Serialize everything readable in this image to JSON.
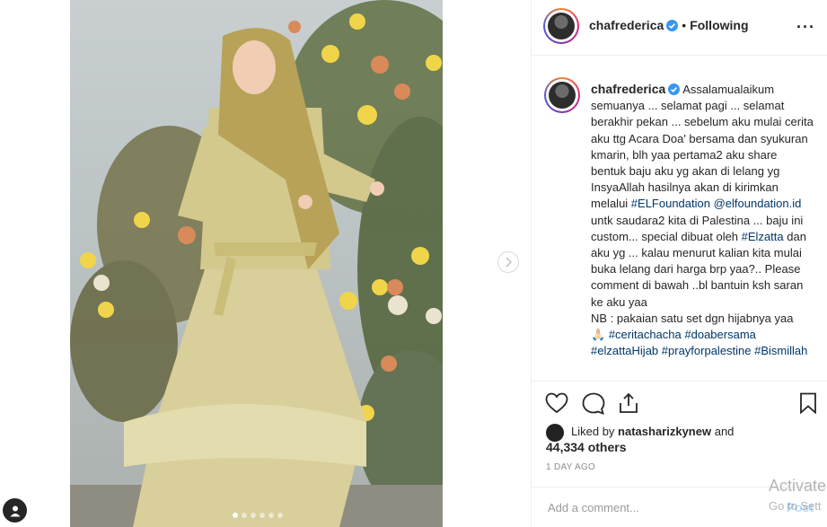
{
  "post": {
    "username": "chafrederica",
    "follow_state": "Following",
    "bullet": "•",
    "more_icon": "···",
    "caption_segments": [
      {
        "t": "Assalamualaikum semuanya ... selamat pagi ... selamat berakhir pekan ... sebelum aku mulai cerita aku ttg Acara Doa' bersama dan syukuran kmarin, blh yaa pertama2 aku share bentuk baju aku yg akan di lelang yg InsyaAllah hasilnya akan di kirimkan melalui ",
        "tag": false
      },
      {
        "t": "#ELFoundation",
        "tag": true
      },
      {
        "t": " ",
        "tag": false
      },
      {
        "t": "@elfoundation.id",
        "tag": true
      },
      {
        "t": " untk saudara2 kita di Palestina ... baju ini custom... special dibuat oleh ",
        "tag": false
      },
      {
        "t": "#Elzatta",
        "tag": true
      },
      {
        "t": " dan aku yg ... kalau menurut kalian kita mulai buka lelang dari harga brp yaa?.. Please comment di bawah ..bl bantuin ksh saran ke aku yaa\nNB : pakaian satu set dgn hijabnya yaa\n🙏🏻 ",
        "tag": false
      },
      {
        "t": "#ceritachacha",
        "tag": true
      },
      {
        "t": " ",
        "tag": false
      },
      {
        "t": "#doabersama",
        "tag": true
      },
      {
        "t": " ",
        "tag": false
      },
      {
        "t": "#elzattaHijab",
        "tag": true
      },
      {
        "t": " ",
        "tag": false
      },
      {
        "t": "#prayforpalestine",
        "tag": true
      },
      {
        "t": " ",
        "tag": false
      },
      {
        "t": "#Bismillah",
        "tag": true
      }
    ],
    "liked_by_prefix": "Liked by",
    "liked_by_user": "natasharizkynew",
    "liked_by_and": "and",
    "likes_count": "44,334 others",
    "timestamp": "1 DAY AGO",
    "comment_placeholder": "Add a comment...",
    "post_button": "Post",
    "carousel_count": 6,
    "carousel_active": 0
  },
  "icons": {
    "verified": "verified-badge-icon",
    "like": "heart-icon",
    "comment": "comment-bubble-icon",
    "share": "share-icon",
    "save": "bookmark-icon",
    "next": "chevron-right-icon",
    "user_tag": "user-tag-icon"
  },
  "colors": {
    "verified": "#3897f0",
    "hashtag": "#00376b",
    "post_button": "#b2dffc"
  },
  "watermark": {
    "line1": "Activate",
    "line2": "Go to Sett"
  }
}
